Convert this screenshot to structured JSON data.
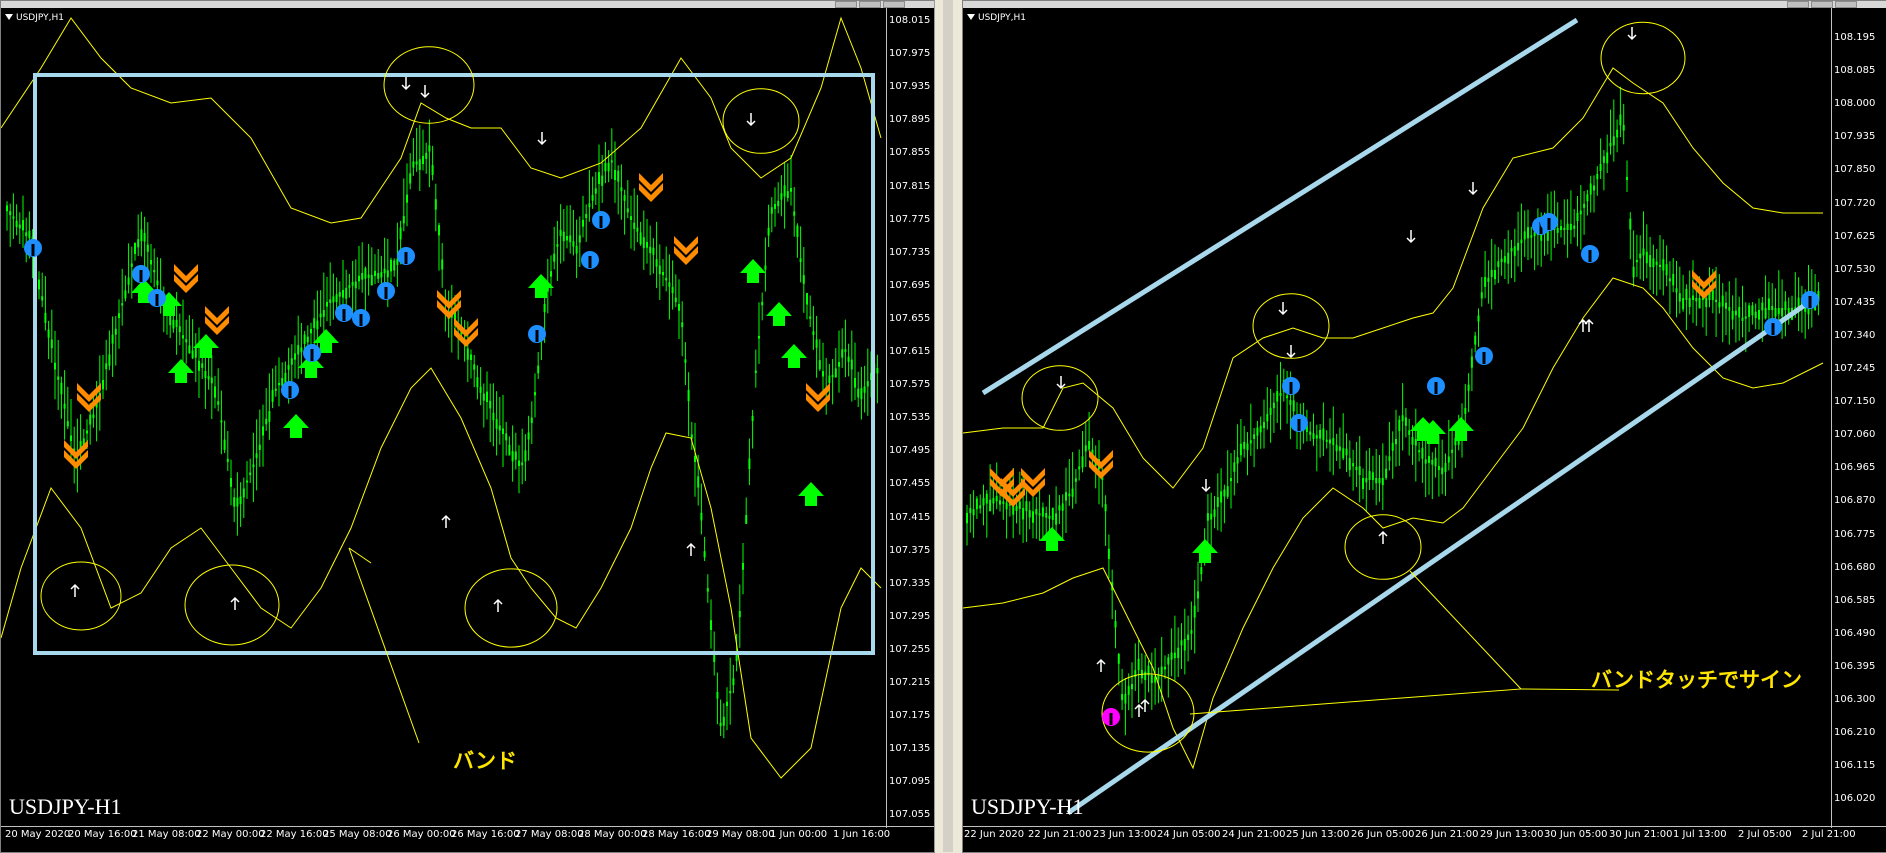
{
  "left_chart": {
    "symbol_label": "USDJPY,H1",
    "watermark": "USDJPY-H1",
    "annotation": "バンド",
    "y_ticks": [
      "108.015",
      "107.975",
      "107.935",
      "107.895",
      "107.855",
      "107.815",
      "107.775",
      "107.735",
      "107.695",
      "107.655",
      "107.615",
      "107.575",
      "107.535",
      "107.495",
      "107.455",
      "107.415",
      "107.375",
      "107.335",
      "107.295",
      "107.255",
      "107.215",
      "107.175",
      "107.135",
      "107.095",
      "107.055"
    ],
    "x_ticks": [
      "20 May 2020",
      "20 May 16:00",
      "21 May 08:00",
      "22 May 00:00",
      "22 May 16:00",
      "25 May 08:00",
      "26 May 00:00",
      "26 May 16:00",
      "27 May 08:00",
      "28 May 00:00",
      "28 May 16:00",
      "29 May 08:00",
      "1 Jun 00:00",
      "1 Jun 16:00"
    ]
  },
  "right_chart": {
    "symbol_label": "USDJPY,H1",
    "watermark": "USDJPY-H1",
    "annotation": "バンドタッチでサイン",
    "y_ticks": [
      "108.195",
      "108.085",
      "108.000",
      "107.935",
      "107.850",
      "107.720",
      "107.625",
      "107.530",
      "107.435",
      "107.340",
      "107.245",
      "107.150",
      "107.060",
      "106.965",
      "106.870",
      "106.775",
      "106.680",
      "106.585",
      "106.490",
      "106.395",
      "106.300",
      "106.210",
      "106.115",
      "106.020"
    ],
    "x_ticks": [
      "22 Jun 2020",
      "22 Jun 21:00",
      "23 Jun 13:00",
      "24 Jun 05:00",
      "24 Jun 21:00",
      "25 Jun 13:00",
      "26 Jun 05:00",
      "26 Jun 21:00",
      "29 Jun 13:00",
      "30 Jun 05:00",
      "30 Jun 21:00",
      "1 Jul 13:00",
      "2 Jul 05:00",
      "2 Jul 21:00"
    ]
  },
  "colors": {
    "background": "#000000",
    "candles": "#00ff00",
    "bands": "#ffff00",
    "box_and_channel": "#a8d8ec",
    "sell_arrow": "#ff8c00",
    "buy_arrow": "#00ff00",
    "dot": "#1e8fff",
    "magenta": "#ff00ff",
    "annotation_text": "#ffe600"
  }
}
